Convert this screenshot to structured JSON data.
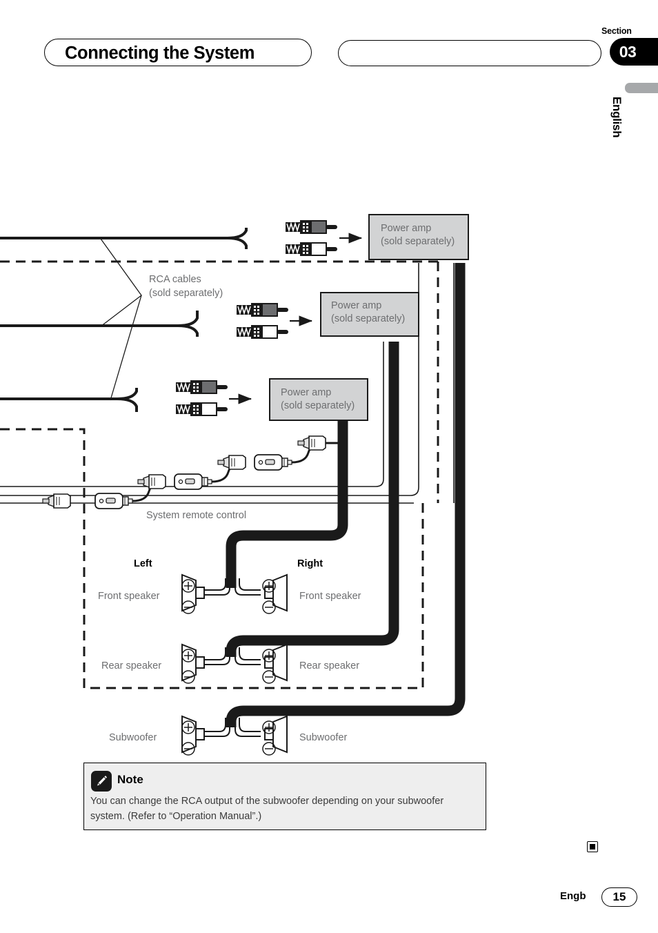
{
  "header": {
    "title": "Connecting the System",
    "right_pill_text": "",
    "section_label": "Section",
    "section_number": "03",
    "language_tab": "English"
  },
  "diagram": {
    "amps": [
      {
        "line1": "Power amp",
        "line2": "(sold  separately)"
      },
      {
        "line1": "Power amp",
        "line2": "(sold separately)"
      },
      {
        "line1": "Power amp",
        "line2": "(sold separately)"
      }
    ],
    "rca_label_line1": "RCA cables",
    "rca_label_line2": "(sold separately)",
    "system_remote_label": "System remote control",
    "channel_left": "Left",
    "channel_right": "Right",
    "speakers": [
      {
        "left": "Front speaker",
        "right": "Front speaker"
      },
      {
        "left": "Rear speaker",
        "right": "Rear speaker"
      },
      {
        "left": "Subwoofer",
        "right": "Subwoofer"
      }
    ],
    "terminal_plus": "+",
    "terminal_minus": "−"
  },
  "note": {
    "title": "Note",
    "body": "You can change the RCA output of the subwoofer depending on your subwoofer system. (Refer to “Operation Manual”.)"
  },
  "footer": {
    "language_code": "Engb",
    "page_number": "15"
  }
}
